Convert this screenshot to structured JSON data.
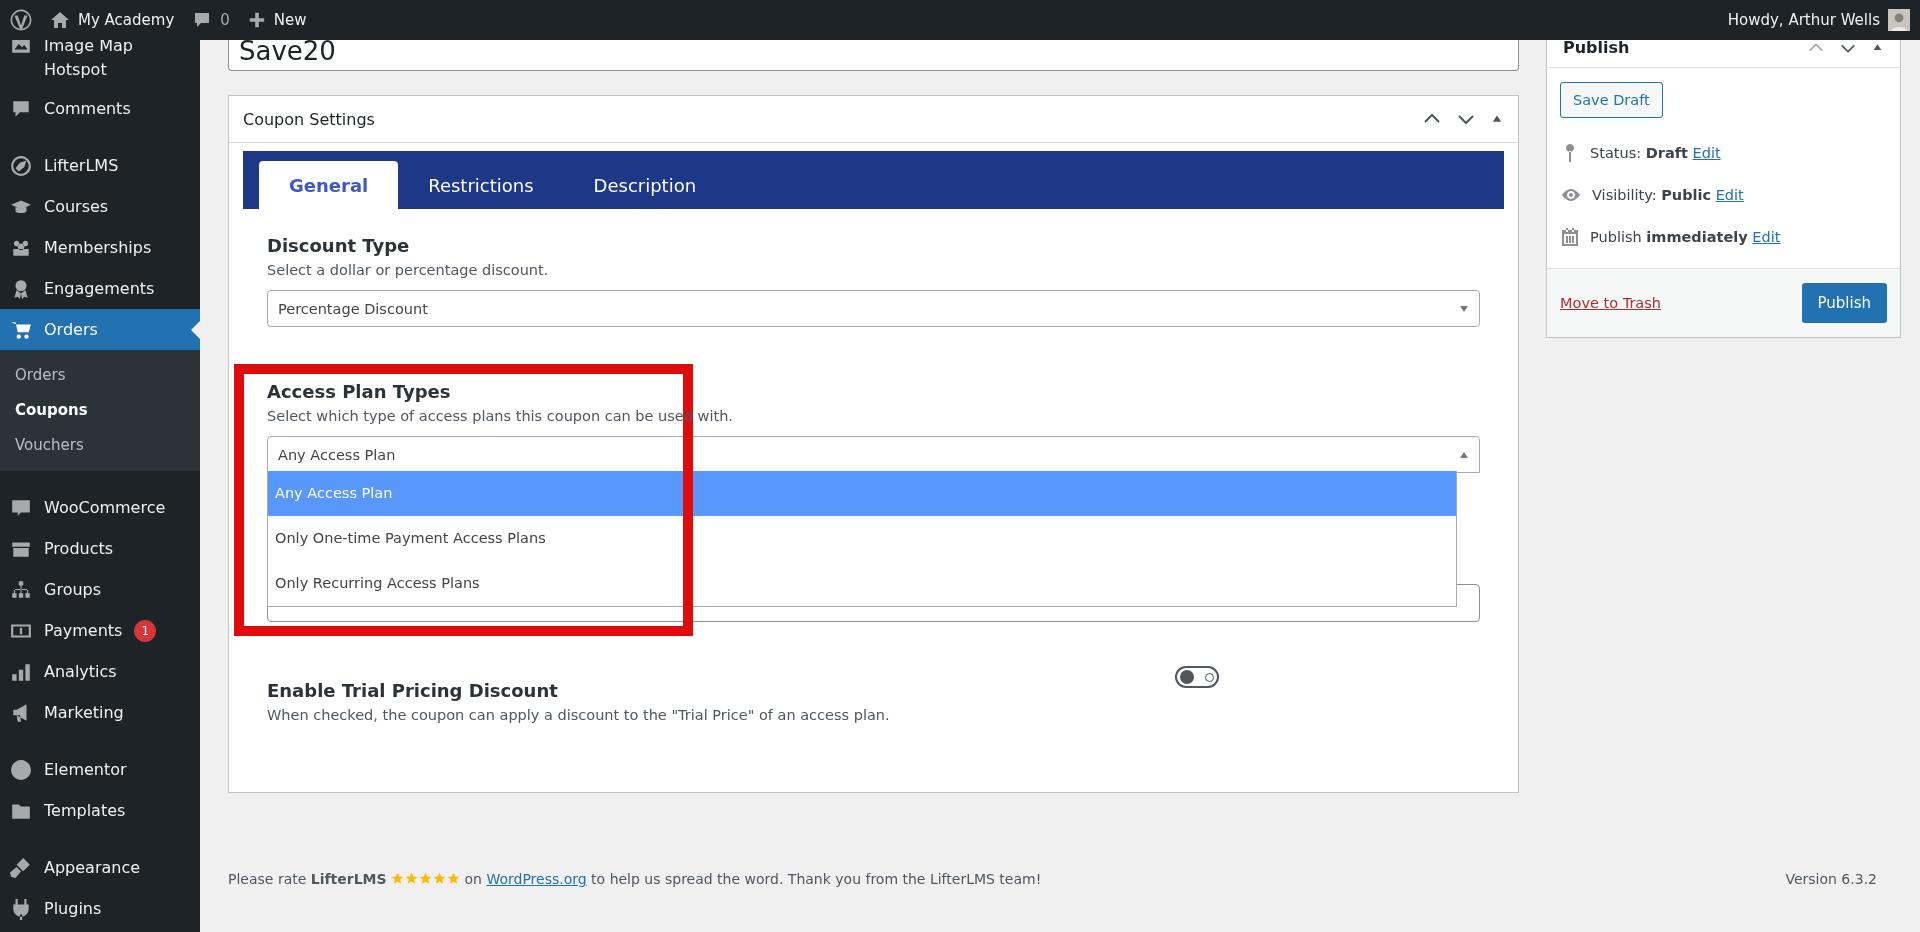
{
  "admin_bar": {
    "site_name": "My Academy",
    "comments_count": "0",
    "new_label": "New",
    "greeting": "Howdy, Arthur Wells"
  },
  "sidebar": {
    "groups": [
      [
        {
          "label": "Image Map Hotspot",
          "selected": false
        },
        {
          "label": "Comments",
          "selected": false
        }
      ],
      [
        {
          "label": "LifterLMS",
          "selected": false
        },
        {
          "label": "Courses",
          "selected": false
        },
        {
          "label": "Memberships",
          "selected": false
        },
        {
          "label": "Engagements",
          "selected": false
        },
        {
          "label": "Orders",
          "selected": true,
          "children": [
            {
              "label": "Orders",
              "selected": false
            },
            {
              "label": "Coupons",
              "selected": true
            },
            {
              "label": "Vouchers",
              "selected": false
            }
          ]
        }
      ],
      [
        {
          "label": "WooCommerce",
          "selected": false
        },
        {
          "label": "Products",
          "selected": false
        },
        {
          "label": "Groups",
          "selected": false
        },
        {
          "label": "Payments",
          "selected": false,
          "badge": "1"
        },
        {
          "label": "Analytics",
          "selected": false
        },
        {
          "label": "Marketing",
          "selected": false
        }
      ],
      [
        {
          "label": "Elementor",
          "selected": false
        },
        {
          "label": "Templates",
          "selected": false
        }
      ],
      [
        {
          "label": "Appearance",
          "selected": false
        },
        {
          "label": "Plugins",
          "selected": false
        }
      ]
    ]
  },
  "title_field": {
    "value": "Save20"
  },
  "coupon_settings": {
    "title": "Coupon Settings",
    "tabs": [
      {
        "label": "General",
        "selected": true
      },
      {
        "label": "Restrictions",
        "selected": false
      },
      {
        "label": "Description",
        "selected": false
      }
    ],
    "fields": [
      {
        "kind": "select",
        "label": "Discount Type",
        "description": "Select a dollar or percentage discount.",
        "value": "Percentage Discount",
        "expanded": false
      },
      {
        "kind": "select",
        "label": "Access Plan Types",
        "description": "Select which type of access plans this coupon can be used with.",
        "value": "Any Access Plan",
        "expanded": true,
        "options": [
          {
            "label": "Any Access Plan",
            "selected": true
          },
          {
            "label": "Only One-time Payment Access Plans",
            "selected": false
          },
          {
            "label": "Only Recurring Access Plans",
            "selected": false
          }
        ]
      },
      {
        "kind": "input"
      },
      {
        "kind": "toggle",
        "label": "Enable Trial Pricing Discount",
        "description": "When checked, the coupon can apply a discount to the \"Trial Price\" of an access plan.",
        "on": false
      }
    ]
  },
  "publish": {
    "title": "Publish",
    "save_draft": "Save Draft",
    "rows": [
      {
        "label": "Status:",
        "value": "Draft",
        "link": "Edit"
      },
      {
        "label": "Visibility:",
        "value": "Public",
        "link": "Edit"
      },
      {
        "label": "Publish",
        "value": "immediately",
        "link": "Edit"
      }
    ],
    "trash": "Move to Trash",
    "button": "Publish"
  },
  "footer": {
    "before": "Please rate **LifterLMS**",
    "stars": 5,
    "on": "on",
    "link": "WordPress.org",
    "after": "to help us spread the word. Thank you from the LifterLMS team!",
    "version": "Version 6.3.2"
  }
}
